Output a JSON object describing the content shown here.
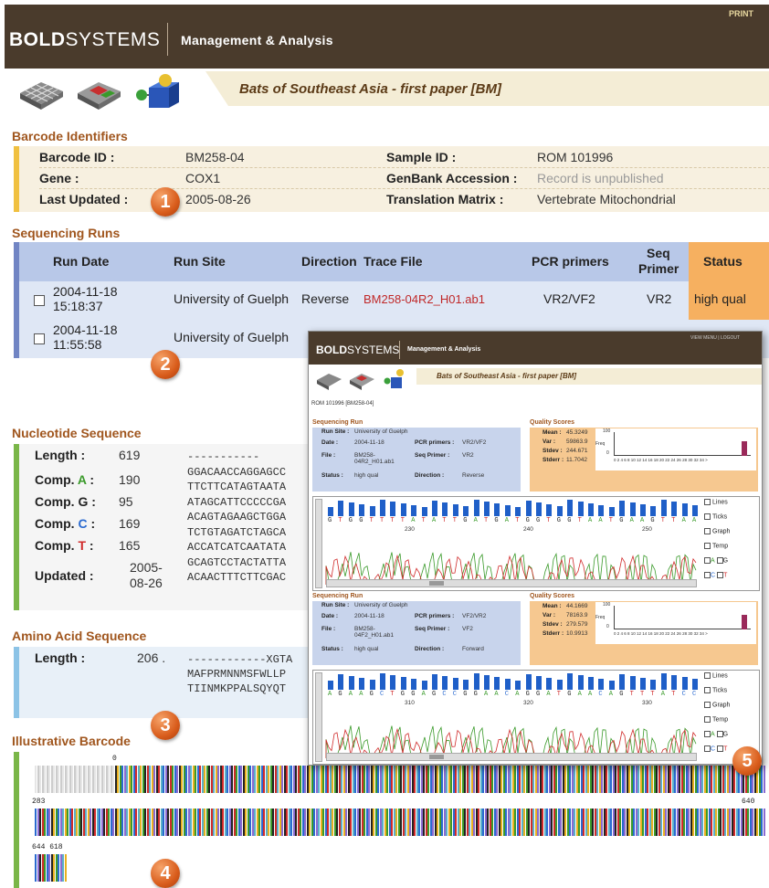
{
  "header": {
    "brand_bold": "BOLD",
    "brand_rest": "SYSTEMS",
    "section": "Management & Analysis",
    "print_label": "PRINT",
    "project_title": "Bats of Southeast Asia - first paper [BM]"
  },
  "barcode_identifiers": {
    "title": "Barcode Identifiers",
    "rows": [
      {
        "l1": "Barcode ID :",
        "v1": "BM258-04",
        "l2": "Sample ID :",
        "v2": "ROM 101996"
      },
      {
        "l1": "Gene :",
        "v1": "COX1",
        "l2": "GenBank Accession :",
        "v2": "Record is unpublished"
      },
      {
        "l1": "Last Updated :",
        "v1": "2005-08-26",
        "l2": "Translation Matrix :",
        "v2": "Vertebrate Mitochondrial"
      }
    ]
  },
  "sequencing_runs": {
    "title": "Sequencing Runs",
    "headers": {
      "date": "Run Date",
      "site": "Run Site",
      "direction": "Direction",
      "trace": "Trace File",
      "pcr": "PCR primers",
      "seq1": "Seq",
      "seq2": "Primer",
      "status": "Status"
    },
    "rows": [
      {
        "date1": "2004-11-18",
        "date2": "15:18:37",
        "site": "University of Guelph",
        "direction": "Reverse",
        "trace": "BM258-04R2_H01.ab1",
        "pcr": "VR2/VF2",
        "seq": "VR2",
        "status": "high qual"
      },
      {
        "date1": "2004-11-18",
        "date2": "11:55:58",
        "site": "University of Guelph"
      }
    ]
  },
  "nucleotide": {
    "title": "Nucleotide Sequence",
    "stats": [
      {
        "label": "Length :",
        "value": "619"
      },
      {
        "label_pre": "Comp. ",
        "label_base": "A",
        "label_post": " :",
        "value": "190",
        "color": "#3a9a2a"
      },
      {
        "label_pre": "Comp. ",
        "label_base": "G",
        "label_post": " :",
        "value": "95",
        "color": "#222222"
      },
      {
        "label_pre": "Comp. ",
        "label_base": "C",
        "label_post": " :",
        "value": "169",
        "color": "#2a6ad0"
      },
      {
        "label_pre": "Comp. ",
        "label_base": "T",
        "label_post": " :",
        "value": "165",
        "color": "#d02a2a"
      },
      {
        "label": "Updated :",
        "value1": "2005-",
        "value2": "08-26"
      }
    ],
    "lines": [
      "-----------",
      "GGACAACCAGGAGCC",
      "TTCTTCATAGTAATA",
      "ATAGCATTCCCCCGA",
      "ACAGTAGAAGCTGGA",
      "TCTGTAGATCTAGCA",
      "ACCATCATCAATATA",
      "GCAGTCCTACTATTA",
      "ACAACTTTCTTCGAC"
    ]
  },
  "amino": {
    "title": "Amino Acid Sequence",
    "length_label": "Length :",
    "length_value": "206 .",
    "lines": [
      "------------XGTA",
      "MAFPRMNNMSFWLLP",
      "TIINMKPPALSQYQT"
    ]
  },
  "barcode": {
    "title": "Illustrative Barcode",
    "labels": {
      "start": "0",
      "row2_start": "283",
      "row2_end": "640",
      "row3": "644 618"
    }
  },
  "markers": [
    "1",
    "2",
    "3",
    "4",
    "5"
  ],
  "popup": {
    "brand_bold": "BOLD",
    "brand_rest": "SYSTEMS",
    "section": "Management & Analysis",
    "nav": "VIEW MENU  |  LOGOUT",
    "project_title": "Bats of Southeast Asia - first paper [BM]",
    "record": "ROM 101996 [BM258-04]",
    "runs": [
      {
        "run_title": "Sequencing Run",
        "quality_title": "Quality Scores",
        "site_label": "Run Site :",
        "site": "University of Guelph",
        "date_label": "Date :",
        "date": "2004-11-18",
        "pcr_label": "PCR primers :",
        "pcr": "VR2/VF2",
        "file_label": "File :",
        "file": "BM258-04R2_H01.ab1",
        "seqp_label": "Seq Primer :",
        "seqp": "VR2",
        "status_label": "Status :",
        "status": "high qual",
        "dir_label": "Direction :",
        "dir": "Reverse",
        "q": [
          {
            "l": "Mean :",
            "v": "45.3249"
          },
          {
            "l": "Var :",
            "v": "59863.9"
          },
          {
            "l": "Stdev :",
            "v": "244.671"
          },
          {
            "l": "Stderr :",
            "v": "11.7042"
          }
        ],
        "bases": "GTGGTTTTATATTGATGATGGTGGTAATGAAGTTAA",
        "ticks": [
          "230",
          "240",
          "250"
        ]
      },
      {
        "run_title": "Sequencing Run",
        "quality_title": "Quality Scores",
        "site_label": "Run Site :",
        "site": "University of Guelph",
        "date_label": "Date :",
        "date": "2004-11-18",
        "pcr_label": "PCR primers :",
        "pcr": "VF2/VR2",
        "file_label": "File :",
        "file": "BM258-04F2_H01.ab1",
        "seqp_label": "Seq Primer :",
        "seqp": "VF2",
        "status_label": "Status :",
        "status": "high qual",
        "dir_label": "Direction :",
        "dir": "Forward",
        "q": [
          {
            "l": "Mean :",
            "v": "44.1669"
          },
          {
            "l": "Var :",
            "v": "78163.9"
          },
          {
            "l": "Stdev :",
            "v": "279.579"
          },
          {
            "l": "Stderr :",
            "v": "10.9913"
          }
        ],
        "bases": "AGAAGCTGGAGCCGGAACAGGATGAACAGTTTATCC",
        "ticks": [
          "310",
          "320",
          "330"
        ]
      }
    ],
    "hist_axis": "0 2 4 6 8 10 12 14 16 18 20 22 24 26 28 30 32 34 >",
    "hist_ylabel": "Freq",
    "hist_y": "100",
    "hist_y0": "0",
    "controls": [
      "Lines",
      "Ticks",
      "Graph",
      "Temp",
      "A",
      "G",
      "C",
      "T"
    ]
  }
}
